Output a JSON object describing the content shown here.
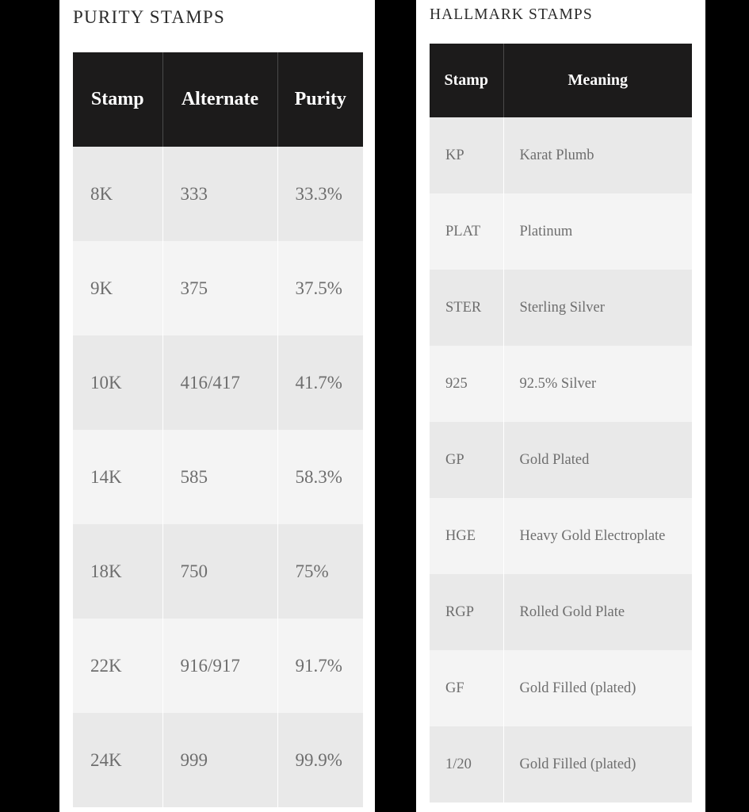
{
  "page": {
    "background_color": "#000000",
    "panel_color": "#ffffff"
  },
  "left_panel": {
    "title": "PURITY STAMPS",
    "table": {
      "columns": [
        "Stamp",
        "Alternate",
        "Purity"
      ],
      "rows": [
        [
          "8K",
          "333",
          "33.3%"
        ],
        [
          "9K",
          "375",
          "37.5%"
        ],
        [
          "10K",
          "416/417",
          "41.7%"
        ],
        [
          "14K",
          "585",
          "58.3%"
        ],
        [
          "18K",
          "750",
          "75%"
        ],
        [
          "22K",
          "916/917",
          "91.7%"
        ],
        [
          "24K",
          "999",
          "99.9%"
        ]
      ]
    }
  },
  "right_panel": {
    "title": "HALLMARK STAMPS",
    "table": {
      "columns": [
        "Stamp",
        "Meaning"
      ],
      "rows": [
        [
          "KP",
          "Karat Plumb"
        ],
        [
          "PLAT",
          "Platinum"
        ],
        [
          "STER",
          "Sterling Silver"
        ],
        [
          "925",
          "92.5% Silver"
        ],
        [
          "GP",
          "Gold Plated"
        ],
        [
          "HGE",
          "Heavy Gold Electroplate"
        ],
        [
          "RGP",
          "Rolled Gold Plate"
        ],
        [
          "GF",
          "Gold Filled (plated)"
        ],
        [
          "1/20",
          "Gold Filled (plated)"
        ]
      ]
    }
  },
  "theme": {
    "header_bg": "#1c1b1b",
    "header_text": "#ffffff",
    "row_odd_bg": "#e9e9e9",
    "row_even_bg": "#f4f4f4",
    "cell_text": "#6e6e6e",
    "title_text": "#2b2b2b"
  }
}
